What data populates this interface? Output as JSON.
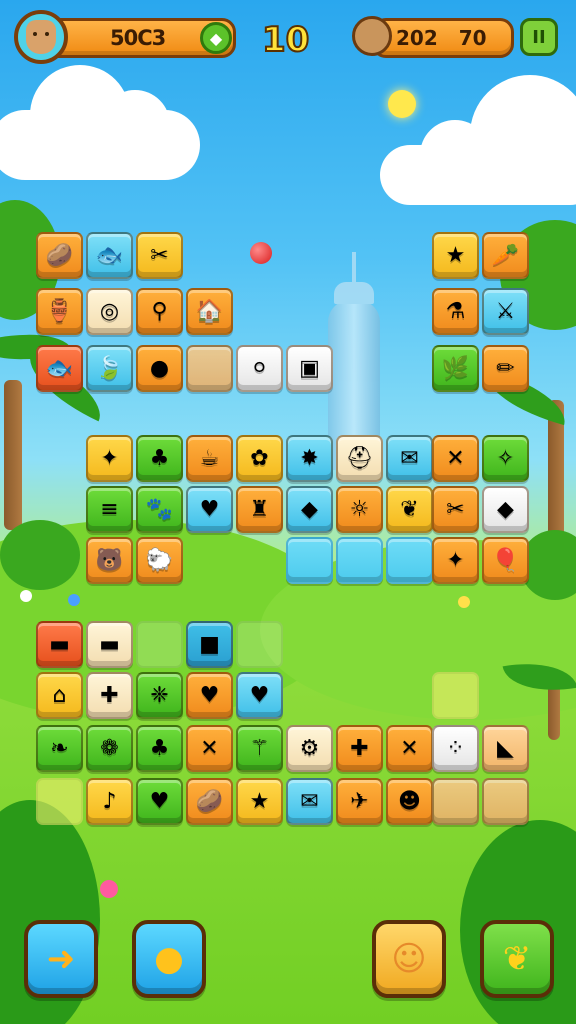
{
  "hud": {
    "score": "50C3",
    "moves": "10",
    "coins": "202 70",
    "avatar_icon": "character-avatar-icon",
    "gem_icon": "green-gem-icon",
    "coin_icon": "pet-coin-icon",
    "pause_icon": "pause-icon"
  },
  "tiles": [
    {
      "id": "t01",
      "style": "t-orange",
      "glyph": "🥔",
      "icon": "potato-icon"
    },
    {
      "id": "t02",
      "style": "t-blue",
      "glyph": "🐟",
      "icon": "fish-icon"
    },
    {
      "id": "t03",
      "style": "t-yellow",
      "glyph": "✂",
      "icon": "scissors-icon"
    },
    {
      "id": "t04",
      "style": "t-yellow",
      "glyph": "★",
      "icon": "star-icon"
    },
    {
      "id": "t05",
      "style": "t-orange",
      "glyph": "🥕",
      "icon": "carrot-icon"
    },
    {
      "id": "t06",
      "style": "t-orange",
      "glyph": "🏺",
      "icon": "vase-icon"
    },
    {
      "id": "t07",
      "style": "t-cream",
      "glyph": "◎",
      "icon": "donut-icon"
    },
    {
      "id": "t08",
      "style": "t-orange",
      "glyph": "⚲",
      "icon": "hydrant-icon"
    },
    {
      "id": "t09",
      "style": "t-orange",
      "glyph": "🏠",
      "icon": "house-icon"
    },
    {
      "id": "t10",
      "style": "t-orange",
      "glyph": "⚗",
      "icon": "tube-icon"
    },
    {
      "id": "t11",
      "style": "t-blue",
      "glyph": "⚔",
      "icon": "sword-icon"
    },
    {
      "id": "t12",
      "style": "t-red",
      "glyph": "🐟",
      "icon": "red-fish-icon"
    },
    {
      "id": "t13",
      "style": "t-blue",
      "glyph": "🍃",
      "icon": "leaf-icon"
    },
    {
      "id": "t14",
      "style": "t-orange",
      "glyph": "●",
      "icon": "green-ball-icon"
    },
    {
      "id": "t15",
      "style": "t-empty-peach",
      "glyph": "",
      "icon": "empty-slot"
    },
    {
      "id": "t16",
      "style": "t-white",
      "glyph": "⚪",
      "icon": "pearl-icon"
    },
    {
      "id": "t17",
      "style": "t-white",
      "glyph": "▣",
      "icon": "box-icon"
    },
    {
      "id": "t18",
      "style": "t-green",
      "glyph": "🌿",
      "icon": "grass-icon"
    },
    {
      "id": "t19",
      "style": "t-orange",
      "glyph": "✏",
      "icon": "pencil-icon"
    },
    {
      "id": "t20",
      "style": "t-yellow",
      "glyph": "✦",
      "icon": "star-burst-icon"
    },
    {
      "id": "t21",
      "style": "t-green",
      "glyph": "♣",
      "icon": "strawberry-icon"
    },
    {
      "id": "t22",
      "style": "t-orange",
      "glyph": "☕",
      "icon": "bowl-icon"
    },
    {
      "id": "t23",
      "style": "t-yellow",
      "glyph": "✿",
      "icon": "cat-icon"
    },
    {
      "id": "t24",
      "style": "t-blue",
      "glyph": "✸",
      "icon": "splash-icon"
    },
    {
      "id": "t25",
      "style": "t-cream",
      "glyph": "⛑",
      "icon": "helmet-icon"
    },
    {
      "id": "t26",
      "style": "t-blue",
      "glyph": "✉",
      "icon": "envelope-icon"
    },
    {
      "id": "t27",
      "style": "t-orange",
      "glyph": "✕",
      "icon": "cross-icon"
    },
    {
      "id": "t28",
      "style": "t-green",
      "glyph": "✧",
      "icon": "blue-bug-icon"
    },
    {
      "id": "t29",
      "style": "t-green",
      "glyph": "≡",
      "icon": "barrel-icon"
    },
    {
      "id": "t30",
      "style": "t-green",
      "glyph": "🐾",
      "icon": "beetle-icon"
    },
    {
      "id": "t31",
      "style": "t-blue",
      "glyph": "♥",
      "icon": "green-heart-icon"
    },
    {
      "id": "t32",
      "style": "t-orange",
      "glyph": "♜",
      "icon": "lamp-icon"
    },
    {
      "id": "t33",
      "style": "t-blue",
      "glyph": "◆",
      "icon": "green-gem-tile-icon"
    },
    {
      "id": "t34",
      "style": "t-orange",
      "glyph": "☼",
      "icon": "sun-bug-icon"
    },
    {
      "id": "t35",
      "style": "t-yellow",
      "glyph": "❦",
      "icon": "sprout-icon"
    },
    {
      "id": "t36",
      "style": "t-orange",
      "glyph": "✂",
      "icon": "tools-icon"
    },
    {
      "id": "t37",
      "style": "t-white",
      "glyph": "◆",
      "icon": "green-shell-icon"
    },
    {
      "id": "t38",
      "style": "t-orange",
      "glyph": "🐻",
      "icon": "bear-icon"
    },
    {
      "id": "t39",
      "style": "t-orange",
      "glyph": "🐑",
      "icon": "sheep-icon"
    },
    {
      "id": "t40",
      "style": "t-empty-blue",
      "glyph": "",
      "icon": "empty-slot"
    },
    {
      "id": "t41",
      "style": "t-empty-blue",
      "glyph": "",
      "icon": "empty-slot"
    },
    {
      "id": "t42",
      "style": "t-empty-blue",
      "glyph": "",
      "icon": "empty-slot"
    },
    {
      "id": "t43",
      "style": "t-orange",
      "glyph": "✦",
      "icon": "sparkle-icon"
    },
    {
      "id": "t44",
      "style": "t-orange",
      "glyph": "🎈",
      "icon": "balloon-icon"
    },
    {
      "id": "t45",
      "style": "t-red",
      "glyph": "▬",
      "icon": "red-bag-icon"
    },
    {
      "id": "t46",
      "style": "t-cream",
      "glyph": "▬",
      "icon": "red-box-icon"
    },
    {
      "id": "t47",
      "style": "t-ghost",
      "glyph": "",
      "icon": "empty-slot"
    },
    {
      "id": "t48",
      "style": "t-purple-frame",
      "glyph": "■",
      "icon": "purple-gem-icon"
    },
    {
      "id": "t49",
      "style": "t-ghost",
      "glyph": "",
      "icon": "empty-slot"
    },
    {
      "id": "t50",
      "style": "t-yellow",
      "glyph": "⌂",
      "icon": "jar-icon"
    },
    {
      "id": "t51",
      "style": "t-cream",
      "glyph": "✚",
      "icon": "pink-cross-icon"
    },
    {
      "id": "t52",
      "style": "t-green",
      "glyph": "❈",
      "icon": "yellow-splash-icon"
    },
    {
      "id": "t53",
      "style": "t-orange",
      "glyph": "♥",
      "icon": "green-heart-icon"
    },
    {
      "id": "t54",
      "style": "t-blue",
      "glyph": "♥",
      "icon": "red-heart-icon"
    },
    {
      "id": "t55",
      "style": "t-ghost-yellow",
      "glyph": "",
      "icon": "empty-slot"
    },
    {
      "id": "t56",
      "style": "t-green",
      "glyph": "❧",
      "icon": "leaf-icon"
    },
    {
      "id": "t57",
      "style": "t-green",
      "glyph": "❁",
      "icon": "flower-ring-icon"
    },
    {
      "id": "t58",
      "style": "t-green",
      "glyph": "♣",
      "icon": "strawberry-icon"
    },
    {
      "id": "t59",
      "style": "t-orange",
      "glyph": "✕",
      "icon": "red-cross-icon"
    },
    {
      "id": "t60",
      "style": "t-green",
      "glyph": "⚚",
      "icon": "branch-icon"
    },
    {
      "id": "t61",
      "style": "t-cream",
      "glyph": "⚙",
      "icon": "gear-icon"
    },
    {
      "id": "t62",
      "style": "t-orange",
      "glyph": "✚",
      "icon": "pink-cross-icon"
    },
    {
      "id": "t63",
      "style": "t-orange",
      "glyph": "✕",
      "icon": "red-cross-icon"
    },
    {
      "id": "t64",
      "style": "t-white",
      "glyph": "⁘",
      "icon": "dice-icon"
    },
    {
      "id": "t65",
      "style": "t-peach",
      "glyph": "◣",
      "icon": "brown-block-icon"
    },
    {
      "id": "t66",
      "style": "t-ghost-yellow",
      "glyph": "",
      "icon": "empty-slot"
    },
    {
      "id": "t67",
      "style": "t-yellow",
      "glyph": "♪",
      "icon": "cherries-icon"
    },
    {
      "id": "t68",
      "style": "t-green",
      "glyph": "♥",
      "icon": "green-heart-icon"
    },
    {
      "id": "t69",
      "style": "t-orange",
      "glyph": "🥔",
      "icon": "potato-icon"
    },
    {
      "id": "t70",
      "style": "t-yellow",
      "glyph": "★",
      "icon": "star-icon"
    },
    {
      "id": "t71",
      "style": "t-blue",
      "glyph": "✉",
      "icon": "envelope-icon"
    },
    {
      "id": "t72",
      "style": "t-orange",
      "glyph": "✈",
      "icon": "pink-plane-icon"
    },
    {
      "id": "t73",
      "style": "t-orange",
      "glyph": "☻",
      "icon": "gray-bug-icon"
    },
    {
      "id": "t74",
      "style": "t-empty-peach",
      "glyph": "",
      "icon": "empty-slot"
    },
    {
      "id": "t75",
      "style": "t-empty-peach",
      "glyph": "",
      "icon": "empty-slot"
    }
  ],
  "controls": {
    "back_icon": "back-arrow-icon",
    "hint_icon": "lemon-hint-icon",
    "pet_icon": "bunny-icon",
    "leaf_icon": "leaf-power-icon"
  }
}
